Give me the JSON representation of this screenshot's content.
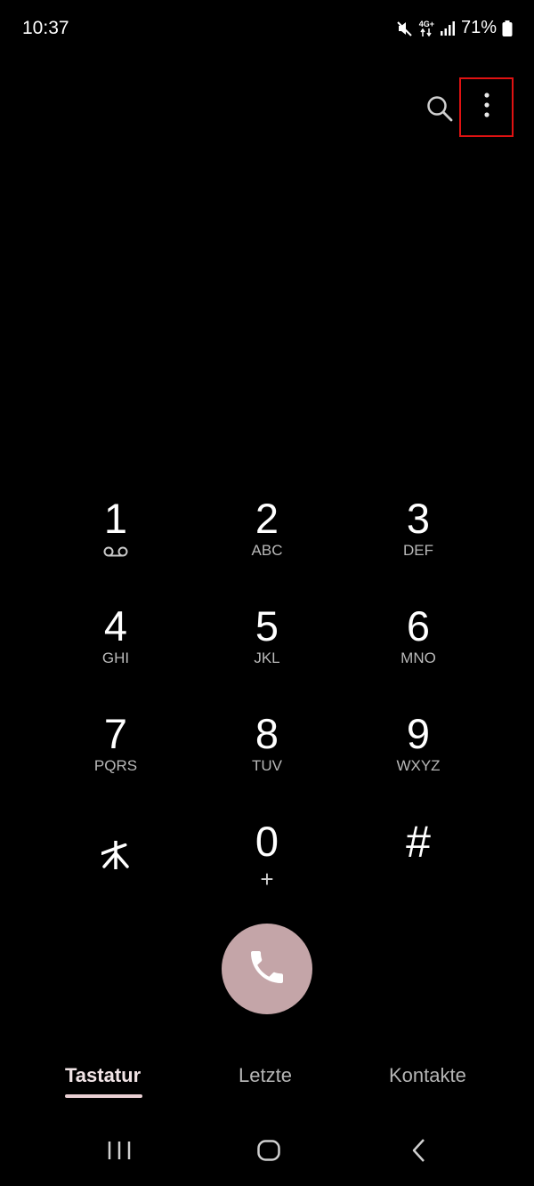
{
  "status_bar": {
    "time": "10:37",
    "network": "4G+",
    "battery": "71%",
    "icons": [
      "mute-icon",
      "network-4g-icon",
      "signal-icon",
      "battery-icon"
    ]
  },
  "toolbar": {
    "search_icon": "search-icon",
    "more_icon": "more-options-icon",
    "highlight_color": "#e01212"
  },
  "keypad": [
    {
      "digit": "1",
      "letters": "",
      "extra": "voicemail-icon"
    },
    {
      "digit": "2",
      "letters": "ABC"
    },
    {
      "digit": "3",
      "letters": "DEF"
    },
    {
      "digit": "4",
      "letters": "GHI"
    },
    {
      "digit": "5",
      "letters": "JKL"
    },
    {
      "digit": "6",
      "letters": "MNO"
    },
    {
      "digit": "7",
      "letters": "PQRS"
    },
    {
      "digit": "8",
      "letters": "TUV"
    },
    {
      "digit": "9",
      "letters": "WXYZ"
    },
    {
      "digit": "*",
      "letters": ""
    },
    {
      "digit": "0",
      "letters": "+"
    },
    {
      "digit": "#",
      "letters": ""
    }
  ],
  "call_button": {
    "icon": "phone-icon",
    "color": "#c4a5a8"
  },
  "tabs": [
    {
      "label": "Tastatur",
      "active": true
    },
    {
      "label": "Letzte",
      "active": false
    },
    {
      "label": "Kontakte",
      "active": false
    }
  ],
  "nav_bar": [
    "recent-apps-icon",
    "home-icon",
    "back-icon"
  ]
}
